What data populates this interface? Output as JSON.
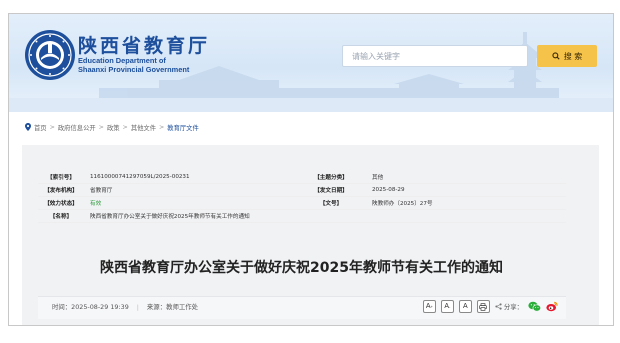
{
  "header": {
    "title_cn": "陕西省教育厅",
    "title_en_line1": "Education Department of",
    "title_en_line2": "Shaanxi Provincial Government",
    "emblem_icon": "education-department-emblem",
    "search": {
      "placeholder": "请输入关键字",
      "button_label": "搜 索",
      "button_icon": "search-icon"
    }
  },
  "breadcrumb": {
    "icon": "location-pin-icon",
    "items": [
      "首页",
      "政府信息公开",
      "政策",
      "其他文件",
      "教育厅文件"
    ],
    "separator": ">"
  },
  "info_table": {
    "rows": [
      {
        "k1": "【索引号】",
        "v1": "11610000741297059L/2025-00231",
        "k2": "【主题分类】",
        "v2": "其他"
      },
      {
        "k1": "【发布机构】",
        "v1": "省教育厅",
        "k2": "【发文日期】",
        "v2": "2025-08-29"
      },
      {
        "k1": "【效力状态】",
        "v1": "有效",
        "k2": "【文号】",
        "v2": "陕教师办〔2025〕27号"
      },
      {
        "k1": "【名称】",
        "v1": "陕西省教育厅办公室关于做好庆祝2025年教师节有关工作的通知"
      }
    ]
  },
  "document": {
    "title": "陕西省教育厅办公室关于做好庆祝2025年教师节有关工作的通知",
    "time_label": "时间：",
    "time": "2025-08-29 19:39",
    "separator": "|",
    "source_label": "来源：",
    "source": "教师工作处",
    "font_buttons": [
      "A",
      "A",
      "A"
    ],
    "font_button_sup": [
      "+",
      "-"
    ],
    "share_label": "分享：",
    "share_icon": "share-icon",
    "print_icon": "print-icon",
    "wechat_icon": "wechat-icon",
    "weibo_icon": "weibo-icon"
  },
  "colors": {
    "brand_blue": "#1d4f9c",
    "search_button": "#f5c24a",
    "valid_green": "#2f9a3c",
    "panel_bg": "#f1f2f4"
  }
}
